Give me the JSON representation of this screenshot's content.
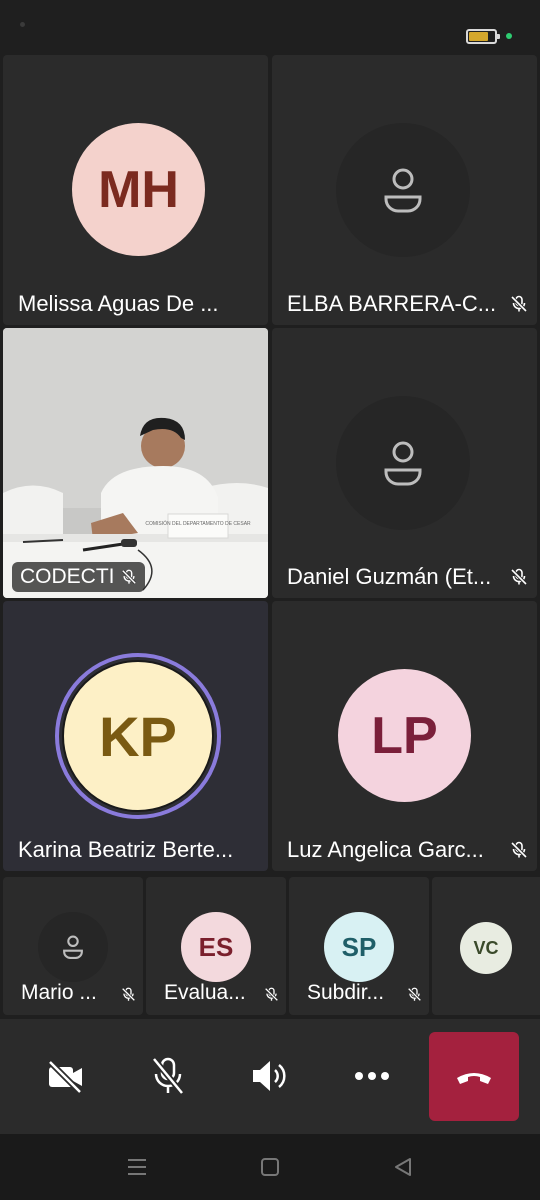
{
  "status_bar": {
    "battery_level": 0.75
  },
  "tiles": [
    {
      "name": "Melissa Aguas De ...",
      "initials": "MH"
    },
    {
      "name": "ELBA BARRERA-C..."
    },
    {
      "name": "CODECTI",
      "video_board": "COMISIÓN DEL DEPARTAMENTO DE CESAR"
    },
    {
      "name": "Daniel Guzmán (Et..."
    },
    {
      "name": "Karina Beatriz Berte...",
      "initials": "KP"
    },
    {
      "name": "Luz Angelica Garc...",
      "initials": "LP"
    }
  ],
  "small_tiles": [
    {
      "name": "Mario ..."
    },
    {
      "name": "Evalua...",
      "initials": "ES"
    },
    {
      "name": "Subdir...",
      "initials": "SP"
    },
    {
      "name": "",
      "initials": "VC"
    }
  ],
  "colors": {
    "background": "#1f1f1f",
    "tile": "#2b2b2b",
    "end_call": "#a4213e",
    "speaking_ring": "#8a7bdc"
  },
  "controls": [
    "camera-off-icon",
    "mic-off-icon",
    "speaker-icon",
    "more-icon",
    "end-call-icon"
  ],
  "nav": [
    "recents-icon",
    "home-icon",
    "back-icon"
  ]
}
